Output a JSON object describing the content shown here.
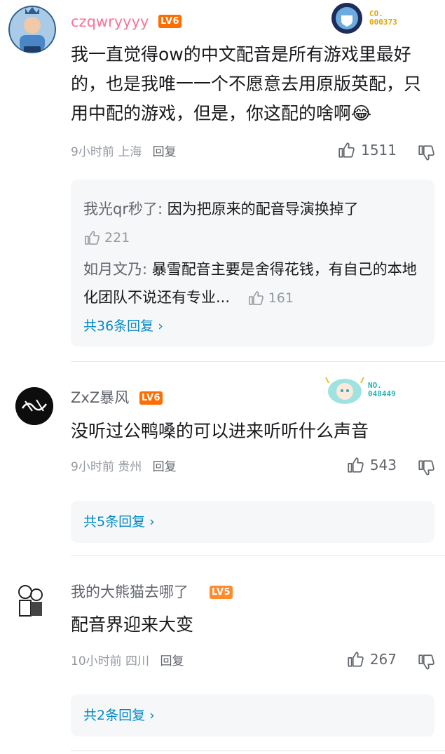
{
  "comments": [
    {
      "username": "czqwryyyy",
      "level": "LV6",
      "medal_no_top": "CO.",
      "medal_no": "000373",
      "text": "我一直觉得ow的中文配音是所有游戏里最好的，也是我唯一一个不愿意去用原版英配，只用中配的游戏，但是，你这配的啥啊😂",
      "time": "9小时前 上海",
      "reply": "回复",
      "likes": "1511",
      "replies": [
        {
          "user": "我光qr秒了:",
          "text": " 因为把原来的配音导演换掉了",
          "likes": "221"
        },
        {
          "user": "如月文乃:",
          "text": " 暴雪配音主要是舍得花钱，有自己的本地化团队不说还有专业...",
          "likes": "161"
        }
      ],
      "more": "共36条回复"
    },
    {
      "username": "ZxZ暴风",
      "level": "LV6",
      "medal_no_top": "NO.",
      "medal_no": "048449",
      "text": "没听过公鸭嗓的可以进来听听什么声音",
      "time": "9小时前 贵州",
      "reply": "回复",
      "likes": "543",
      "more": "共5条回复"
    },
    {
      "username": "我的大熊猫去哪了",
      "level": "LV5",
      "text": "配音界迎来大变",
      "time": "10小时前 四川",
      "reply": "回复",
      "likes": "267",
      "more": "共2条回复"
    }
  ],
  "colors": {
    "username_vip": "#fb7299",
    "username_normal": "#61666d",
    "lv6": "#ff6c00",
    "lv5": "#ff8b2c",
    "link": "#008ac5"
  }
}
